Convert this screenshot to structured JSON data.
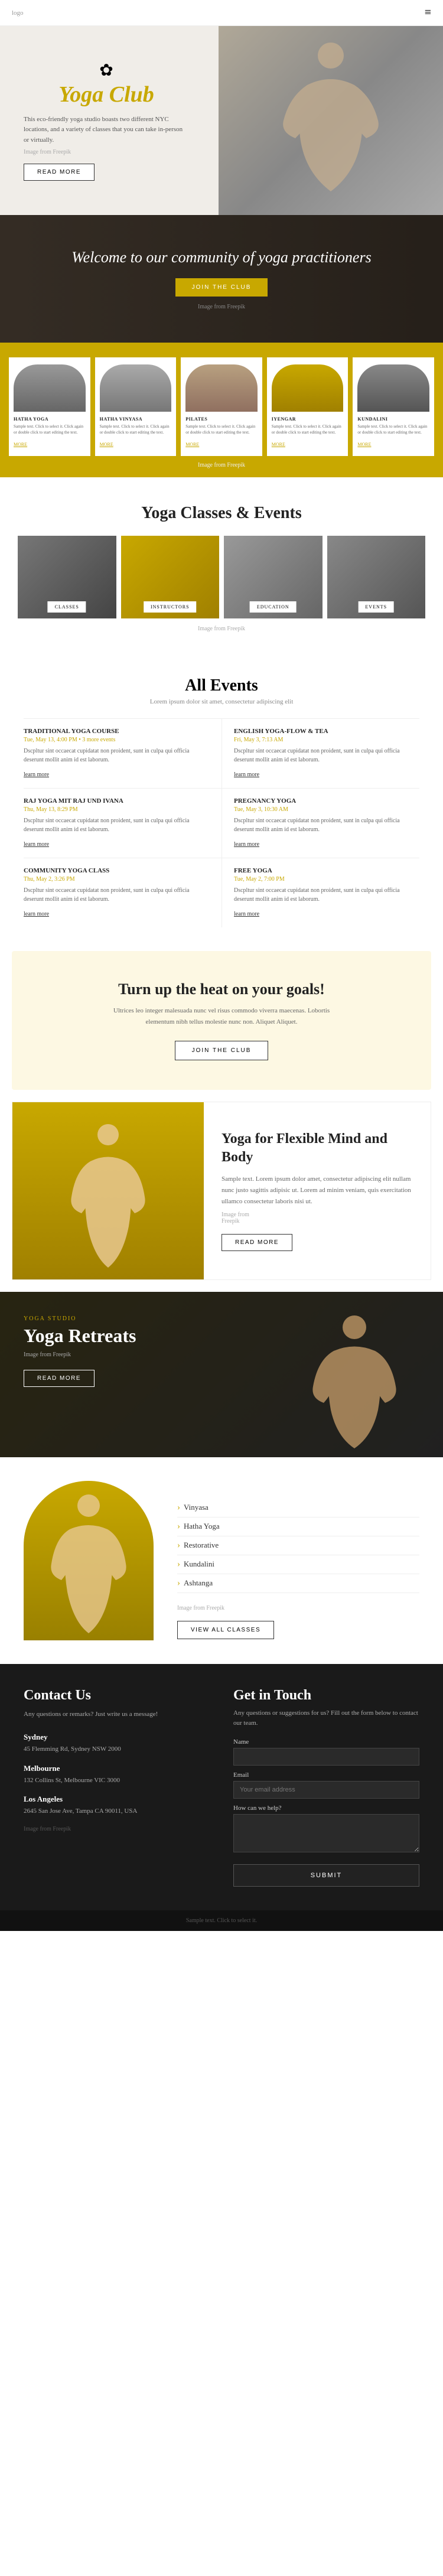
{
  "nav": {
    "logo": "logo",
    "menu_icon": "≡"
  },
  "hero": {
    "title": "Yoga Club",
    "description": "This eco-friendly yoga studio boasts two different NYC locations, and a variety of classes that you can take in-person or virtually.",
    "image_credit": "Image from Freepik",
    "read_more": "READ MORE"
  },
  "welcome": {
    "subtitle": "JOIN THE CLUB",
    "heading": "Welcome to our community of yoga practitioners",
    "join_btn": "JOIN THE CLUB",
    "image_credit": "Image from Freepik"
  },
  "yoga_types": {
    "image_credit": "Image from Freepik",
    "types": [
      {
        "title": "HATHA YOGA",
        "desc": "Sample text. Click to select it. Click again or double click to start editing the text.",
        "more": "MORE"
      },
      {
        "title": "HATHA VINYASA",
        "desc": "Sample text. Click to select it. Click again or double click to start editing the text.",
        "more": "MORE"
      },
      {
        "title": "PILATES",
        "desc": "Sample text. Click to select it. Click again or double click to start editing the text.",
        "more": "MORE"
      },
      {
        "title": "IYENGAR",
        "desc": "Sample text. Click to select it. Click again or double click to start editing the text.",
        "more": "MORE"
      },
      {
        "title": "KUNDALINI",
        "desc": "Sample text. Click to select it. Click again or double click to start editing the text.",
        "more": "MORE"
      }
    ]
  },
  "classes_events": {
    "heading": "Yoga Classes & Events",
    "cards": [
      {
        "label": "CLASSES"
      },
      {
        "label": "INSTRUCTORS"
      },
      {
        "label": "EDUCATION"
      },
      {
        "label": "EVENTS"
      }
    ],
    "image_credit": "Image from Freepik"
  },
  "all_events": {
    "heading": "All Events",
    "subtitle": "Lorem ipsum dolor sit amet, consectetur adipiscing elit",
    "events": [
      {
        "title": "TRADITIONAL YOGA COURSE",
        "date": "Tue, May 13, 4:00 PM • 3 more events",
        "desc": "Dscpltur sint occaecat cupidatat non proident, sunt in culpa qui officia deserunt mollit anim id est laborum.",
        "link": "learn more"
      },
      {
        "title": "ENGLISH YOGA-FLOW & TEA",
        "date": "Fri, May 3, 7:13 AM",
        "desc": "Dscpltur sint occaecat cupidatat non proident, sunt in culpa qui officia deserunt mollit anim id est laborum.",
        "link": "learn more"
      },
      {
        "title": "RAJ YOGA MIT RAJ UND IVANA",
        "date": "Thu, May 13, 8:29 PM",
        "desc": "Dscpltur sint occaecat cupidatat non proident, sunt in culpa qui officia deserunt mollit anim id est laborum.",
        "link": "learn more"
      },
      {
        "title": "PREGNANCY YOGA",
        "date": "Tue, May 3, 10:30 AM",
        "desc": "Dscpltur sint occaecat cupidatat non proident, sunt in culpa qui officia deserunt mollit anim id est laborum.",
        "link": "learn more"
      },
      {
        "title": "COMMUNITY YOGA CLASS",
        "date": "Thu, May 2, 3:26 PM",
        "desc": "Dscpltur sint occaecat cupidatat non proident, sunt in culpa qui officia deserunt mollit anim id est laborum.",
        "link": "learn more"
      },
      {
        "title": "FREE YOGA",
        "date": "Tue, May 2, 7:00 PM",
        "desc": "Dscpltur sint occaecat cupidatat non proident, sunt in culpa qui officia deserunt mollit anim id est laborum.",
        "link": "learn more"
      }
    ]
  },
  "cta_banner": {
    "heading": "Turn up the heat on your goals!",
    "desc": "Ultrices leo integer malesuada nunc vel risus commodo viverra maecenas. Lobortis elementum nibh tellus molestie nunc non. Aliquet Aliquet.",
    "btn_label": "JOIN THE CLUB"
  },
  "flex_mind": {
    "heading": "Yoga for Flexible Mind and Body",
    "desc": "Sample text. Lorem ipsum dolor amet, consectetur adipiscing elit nullam nunc justo sagittis adipisic ut. Lorem ad minim veniam, quis exercitation ullamco consectetur laboris nisi ut.",
    "image_credit": "Image from\nFreepik",
    "btn_label": "READ MORE"
  },
  "retreats": {
    "label": "YOGA STUDIO",
    "title": "Yoga Retreats",
    "image_credit": "Image from Freepik",
    "btn_label": "READ MORE"
  },
  "classes_list": {
    "items": [
      "Vinyasa",
      "Hatha Yoga",
      "Restorative",
      "Kundalini",
      "Ashtanga"
    ],
    "image_credit": "Image from Freepik",
    "btn_label": "VIEW ALL CLASSES"
  },
  "contact": {
    "heading": "Contact Us",
    "desc": "Any questions or remarks? Just write us a message!",
    "locations": [
      {
        "city": "Sydney",
        "address": "45 Flemming Rd, Sydney NSW 2000"
      },
      {
        "city": "Melbourne",
        "address": "132 Collins St, Melbourne VIC 3000"
      },
      {
        "city": "Los Angeles",
        "address": "2645 San Jose Ave, Tampa CA 90011, USA"
      }
    ],
    "image_credit": "Image from Freepik",
    "form": {
      "heading": "Get in Touch",
      "desc": "Any questions or suggestions for us? Fill out the form below to contact our team.",
      "name_label": "Name",
      "email_label": "Email",
      "email_placeholder": "Your email address",
      "message_label": "How can we help?",
      "submit_btn": "SUBMIT"
    }
  },
  "footer": {
    "text": "Sample text. Click to select it."
  },
  "more_label": "More"
}
